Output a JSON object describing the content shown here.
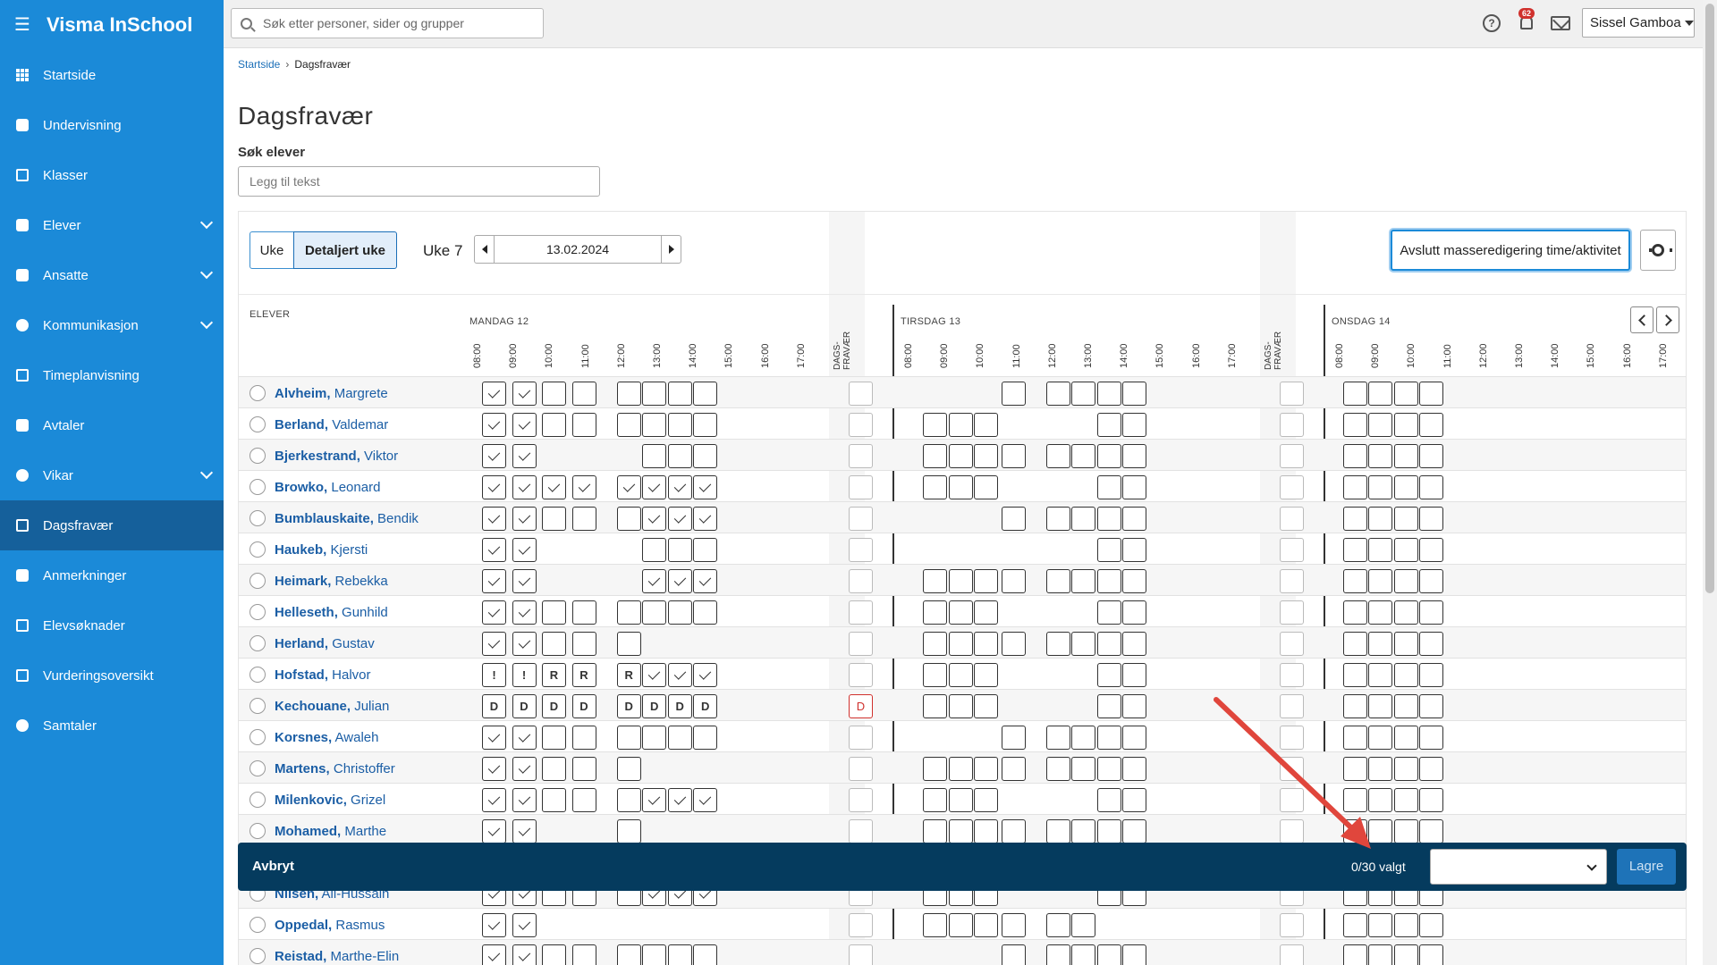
{
  "app": {
    "title": "Visma InSchool"
  },
  "topbar": {
    "search_placeholder": "Søk etter personer, sider og grupper",
    "notification_count": "62",
    "help_glyph": "?",
    "user_name": "Sissel Gamboa"
  },
  "sidebar": {
    "items": [
      {
        "label": "Startside",
        "icon": "grid-icon",
        "expandable": false,
        "active": false
      },
      {
        "label": "Undervisning",
        "icon": "book-icon",
        "expandable": false,
        "active": false
      },
      {
        "label": "Klasser",
        "icon": "board-icon",
        "expandable": false,
        "active": false
      },
      {
        "label": "Elever",
        "icon": "student-icon",
        "expandable": true,
        "active": false
      },
      {
        "label": "Ansatte",
        "icon": "briefcase-icon",
        "expandable": true,
        "active": false
      },
      {
        "label": "Kommunikasjon",
        "icon": "chat-icon",
        "expandable": true,
        "active": false
      },
      {
        "label": "Timeplanvisning",
        "icon": "calendar-icon",
        "expandable": false,
        "active": false
      },
      {
        "label": "Avtaler",
        "icon": "calendar-check-icon",
        "expandable": false,
        "active": false
      },
      {
        "label": "Vikar",
        "icon": "swap-icon",
        "expandable": true,
        "active": false
      },
      {
        "label": "Dagsfravær",
        "icon": "user-check-icon",
        "expandable": false,
        "active": true
      },
      {
        "label": "Anmerkninger",
        "icon": "hand-icon",
        "expandable": false,
        "active": false
      },
      {
        "label": "Elevsøknader",
        "icon": "inbox-icon",
        "expandable": false,
        "active": false
      },
      {
        "label": "Vurderingsoversikt",
        "icon": "board-icon",
        "expandable": false,
        "active": false
      },
      {
        "label": "Samtaler",
        "icon": "chat-icon",
        "expandable": false,
        "active": false
      }
    ]
  },
  "breadcrumb": {
    "home": "Startside",
    "current": "Dagsfravær"
  },
  "page": {
    "title": "Dagsfravær",
    "search_label": "Søk elever",
    "search_placeholder": "Legg til tekst"
  },
  "toolbar": {
    "view_week": "Uke",
    "view_detailed": "Detaljert uke",
    "week_label": "Uke 7",
    "date": "13.02.2024",
    "mass_edit_label": "Avslutt masseredigering time/aktivitet"
  },
  "grid": {
    "students_header": "ELEVER",
    "dags_label": "DAGS-\nFRAVÆR",
    "days": [
      {
        "label": "MANDAG 12"
      },
      {
        "label": "TIRSDAG 13"
      },
      {
        "label": "ONSDAG 14"
      }
    ],
    "hours": [
      "08:00",
      "09:00",
      "10:00",
      "11:00",
      "12:00",
      "13:00",
      "14:00",
      "15:00",
      "16:00",
      "17:00"
    ],
    "students": [
      {
        "last": "Alvheim,",
        "first": "Margrete",
        "mon": [
          "c",
          "c",
          "e",
          "e",
          "e",
          "e",
          "e",
          "e"
        ],
        "monSlots": [
          0,
          1,
          2,
          3,
          4.5,
          5.35,
          6.2,
          7.05
        ],
        "dag": "",
        "tue": [
          3,
          4.5,
          5.35,
          6.2,
          7.05
        ],
        "wed": [
          0,
          0.85,
          1.7,
          2.55
        ]
      },
      {
        "last": "Berland,",
        "first": "Valdemar",
        "mon": [
          "c",
          "c",
          "e",
          "e",
          "e",
          "e",
          "e",
          "e"
        ],
        "monSlots": [
          0,
          1,
          2,
          3,
          4.5,
          5.35,
          6.2,
          7.05
        ],
        "dag": "",
        "tue": [
          0.4,
          1.25,
          2.1,
          6.2,
          7.05
        ],
        "wed": [
          0,
          0.85,
          1.7,
          2.55
        ]
      },
      {
        "last": "Bjerkestrand,",
        "first": "Viktor",
        "mon": [
          "c",
          "c",
          "e",
          "e",
          "e"
        ],
        "monSlots": [
          0,
          1,
          5.35,
          6.2,
          7.05
        ],
        "dag": "",
        "tue": [
          0.4,
          1.25,
          2.1,
          3,
          4.5,
          5.35,
          6.2,
          7.05
        ],
        "wed": [
          0,
          0.85,
          1.7,
          2.55
        ]
      },
      {
        "last": "Browko,",
        "first": "Leonard",
        "mon": [
          "c",
          "c",
          "c",
          "c",
          "c",
          "c",
          "c",
          "c"
        ],
        "monSlots": [
          0,
          1,
          2,
          3,
          4.5,
          5.35,
          6.2,
          7.05
        ],
        "dag": "",
        "tue": [
          0.4,
          1.25,
          2.1,
          6.2,
          7.05
        ],
        "wed": [
          0,
          0.85,
          1.7,
          2.55
        ]
      },
      {
        "last": "Bumblauskaite,",
        "first": "Bendik",
        "mon": [
          "c",
          "c",
          "e",
          "e",
          "e",
          "c",
          "c",
          "c"
        ],
        "monSlots": [
          0,
          1,
          2,
          3,
          4.5,
          5.35,
          6.2,
          7.05
        ],
        "dag": "",
        "tue": [
          3,
          4.5,
          5.35,
          6.2,
          7.05
        ],
        "wed": [
          0,
          0.85,
          1.7,
          2.55
        ]
      },
      {
        "last": "Haukeb,",
        "first": "Kjersti",
        "mon": [
          "c",
          "c",
          "e",
          "e",
          "e"
        ],
        "monSlots": [
          0,
          1,
          5.35,
          6.2,
          7.05
        ],
        "dag": "",
        "tue": [
          6.2,
          7.05
        ],
        "wed": [
          0,
          0.85,
          1.7,
          2.55
        ]
      },
      {
        "last": "Heimark,",
        "first": "Rebekka",
        "mon": [
          "c",
          "c",
          "c",
          "c",
          "c"
        ],
        "monSlots": [
          0,
          1,
          5.35,
          6.2,
          7.05
        ],
        "dag": "",
        "tue": [
          0.4,
          1.25,
          2.1,
          3,
          4.5,
          5.35,
          6.2,
          7.05
        ],
        "wed": [
          0,
          0.85,
          1.7,
          2.55
        ]
      },
      {
        "last": "Helleseth,",
        "first": "Gunhild",
        "mon": [
          "c",
          "c",
          "e",
          "e",
          "e",
          "e",
          "e",
          "e"
        ],
        "monSlots": [
          0,
          1,
          2,
          3,
          4.5,
          5.35,
          6.2,
          7.05
        ],
        "dag": "",
        "tue": [
          0.4,
          1.25,
          2.1,
          6.2,
          7.05
        ],
        "wed": [
          0,
          0.85,
          1.7,
          2.55
        ]
      },
      {
        "last": "Herland,",
        "first": "Gustav",
        "mon": [
          "c",
          "c",
          "e",
          "e",
          "e"
        ],
        "monSlots": [
          0,
          1,
          2,
          3,
          4.5
        ],
        "dag": "",
        "tue": [
          0.4,
          1.25,
          2.1,
          3,
          4.5,
          5.35,
          6.2,
          7.05
        ],
        "wed": [
          0,
          0.85,
          1.7,
          2.55
        ]
      },
      {
        "last": "Hofstad,",
        "first": "Halvor",
        "mon": [
          "!",
          "!",
          "R",
          "R",
          "R",
          "c",
          "c",
          "c"
        ],
        "monSlots": [
          0,
          1,
          2,
          3,
          4.5,
          5.35,
          6.2,
          7.05
        ],
        "dag": "",
        "tue": [
          0.4,
          1.25,
          2.1,
          6.2,
          7.05
        ],
        "wed": [
          0,
          0.85,
          1.7,
          2.55
        ]
      },
      {
        "last": "Kechouane,",
        "first": "Julian",
        "mon": [
          "D",
          "D",
          "D",
          "D",
          "D",
          "D",
          "D",
          "D"
        ],
        "monSlots": [
          0,
          1,
          2,
          3,
          4.5,
          5.35,
          6.2,
          7.05
        ],
        "dag": "D",
        "tue": [
          0.4,
          1.25,
          2.1,
          6.2,
          7.05
        ],
        "wed": [
          0,
          0.85,
          1.7,
          2.55
        ]
      },
      {
        "last": "Korsnes,",
        "first": "Awaleh",
        "mon": [
          "c",
          "c",
          "e",
          "e",
          "e",
          "e",
          "e",
          "e"
        ],
        "monSlots": [
          0,
          1,
          2,
          3,
          4.5,
          5.35,
          6.2,
          7.05
        ],
        "dag": "",
        "tue": [
          3,
          4.5,
          5.35,
          6.2,
          7.05
        ],
        "wed": [
          0,
          0.85,
          1.7,
          2.55
        ]
      },
      {
        "last": "Martens,",
        "first": "Christoffer",
        "mon": [
          "c",
          "c",
          "e",
          "e",
          "e"
        ],
        "monSlots": [
          0,
          1,
          2,
          3,
          4.5
        ],
        "dag": "",
        "tue": [
          0.4,
          1.25,
          2.1,
          3,
          4.5,
          5.35,
          6.2,
          7.05
        ],
        "wed": [
          0,
          0.85,
          1.7,
          2.55
        ]
      },
      {
        "last": "Milenkovic,",
        "first": "Grizel",
        "mon": [
          "c",
          "c",
          "e",
          "e",
          "e",
          "c",
          "c",
          "c"
        ],
        "monSlots": [
          0,
          1,
          2,
          3,
          4.5,
          5.35,
          6.2,
          7.05
        ],
        "dag": "",
        "tue": [
          0.4,
          1.25,
          2.1,
          6.2,
          7.05
        ],
        "wed": [
          0,
          0.85,
          1.7,
          2.55
        ]
      },
      {
        "last": "Mohamed,",
        "first": "Marthe",
        "mon": [
          "c",
          "c",
          "e"
        ],
        "monSlots": [
          0,
          1,
          4.5
        ],
        "dag": "",
        "tue": [
          0.4,
          1.25,
          2.1,
          3,
          4.5,
          5.35,
          6.2,
          7.05
        ],
        "wed": [
          0,
          0.85,
          1.7,
          2.55
        ]
      },
      {
        "last": "",
        "first": "",
        "mon": [],
        "monSlots": [],
        "dag": "",
        "tue": [],
        "wed": []
      },
      {
        "last": "Nilsen,",
        "first": "Ali-Hussain",
        "mon": [
          "c",
          "c",
          "e",
          "e",
          "e",
          "c",
          "c",
          "c"
        ],
        "monSlots": [
          0,
          1,
          2,
          3,
          4.5,
          5.35,
          6.2,
          7.05
        ],
        "dag": "",
        "tue": [
          0.4,
          1.25,
          2.1,
          6.2,
          7.05
        ],
        "wed": [
          0,
          0.85,
          1.7,
          2.55
        ]
      },
      {
        "last": "Oppedal,",
        "first": "Rasmus",
        "mon": [
          "c",
          "c"
        ],
        "monSlots": [
          0,
          1
        ],
        "dag": "",
        "tue": [
          0.4,
          1.25,
          2.1,
          3,
          4.5,
          5.35
        ],
        "wed": [
          0,
          0.85,
          1.7,
          2.55
        ]
      },
      {
        "last": "Reistad,",
        "first": "Marthe-Elin",
        "mon": [
          "c",
          "c",
          "e",
          "e",
          "e",
          "e",
          "e",
          "e"
        ],
        "monSlots": [
          0,
          1,
          2,
          3,
          4.5,
          5.35,
          6.2,
          7.05
        ],
        "dag": "",
        "tue": [
          3,
          4.5,
          5.35,
          6.2,
          7.05
        ],
        "wed": [
          0,
          0.85,
          1.7,
          2.55
        ]
      }
    ]
  },
  "action_bar": {
    "cancel": "Avbryt",
    "selected": "0/30 valgt",
    "save": "Lagre"
  },
  "colors": {
    "sidebar": "#1b8ad8",
    "sidebar_active": "#15609b",
    "action_bar": "#053b5e",
    "annotation": "#e0463c"
  }
}
